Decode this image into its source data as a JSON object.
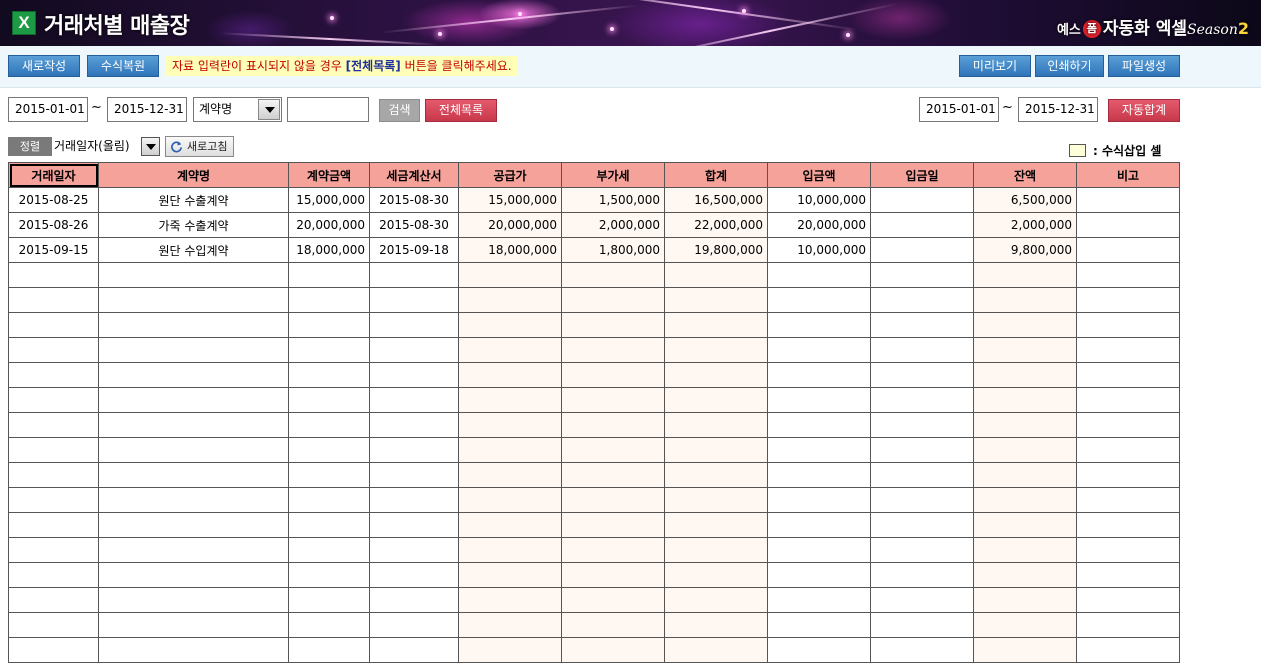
{
  "window": {
    "title": "거래처별 매출장",
    "app_icon": "excel-icon"
  },
  "brand": {
    "prefix": "예스",
    "badge": "폼",
    "name": "자동화 엑셀",
    "season": "Season",
    "season_number": "2"
  },
  "toolbar": {
    "new_label": "새로작성",
    "restore_label": "수식복원",
    "notice_before": "자료 입력란이 표시되지  않을 경우 ",
    "notice_highlight": "[전체목록]",
    "notice_after": " 버튼을 클릭해주세요.",
    "preview_label": "미리보기",
    "print_label": "인쇄하기",
    "file_label": "파일생성"
  },
  "filter": {
    "date_from": "2015-01-01",
    "date_to": "2015-12-31",
    "separator": "~",
    "search_field": "계약명",
    "search_value": "",
    "search_label": "검색",
    "all_list_label": "전체목록",
    "sum_date_from": "2015-01-01",
    "sum_date_to": "2015-12-31",
    "auto_sum_label": "자동합계"
  },
  "sort": {
    "label": "정렬",
    "value": "거래일자(올림)",
    "refresh_label": "새로고침"
  },
  "legend": {
    "text": ": 수식삽입 셀",
    "color": "#ffffd8"
  },
  "table": {
    "columns": [
      "거래일자",
      "계약명",
      "계약금액",
      "세금계산서",
      "공급가",
      "부가세",
      "합계",
      "입금액",
      "입금일",
      "잔액",
      "비고"
    ],
    "rows": [
      [
        "2015-08-25",
        "원단 수출계약",
        "15,000,000",
        "2015-08-30",
        "15,000,000",
        "1,500,000",
        "16,500,000",
        "10,000,000",
        "",
        "6,500,000",
        ""
      ],
      [
        "2015-08-26",
        "가죽 수출계약",
        "20,000,000",
        "2015-08-30",
        "20,000,000",
        "2,000,000",
        "22,000,000",
        "20,000,000",
        "",
        "2,000,000",
        ""
      ],
      [
        "2015-09-15",
        "원단 수입계약",
        "18,000,000",
        "2015-09-18",
        "18,000,000",
        "1,800,000",
        "19,800,000",
        "10,000,000",
        "",
        "9,800,000",
        ""
      ]
    ],
    "empty_rows": 16
  },
  "colors": {
    "header_bg": "#f5a29a",
    "button_blue": "#2f74b9",
    "button_red": "#c8384b",
    "formula_cell": "#fff8f2"
  }
}
